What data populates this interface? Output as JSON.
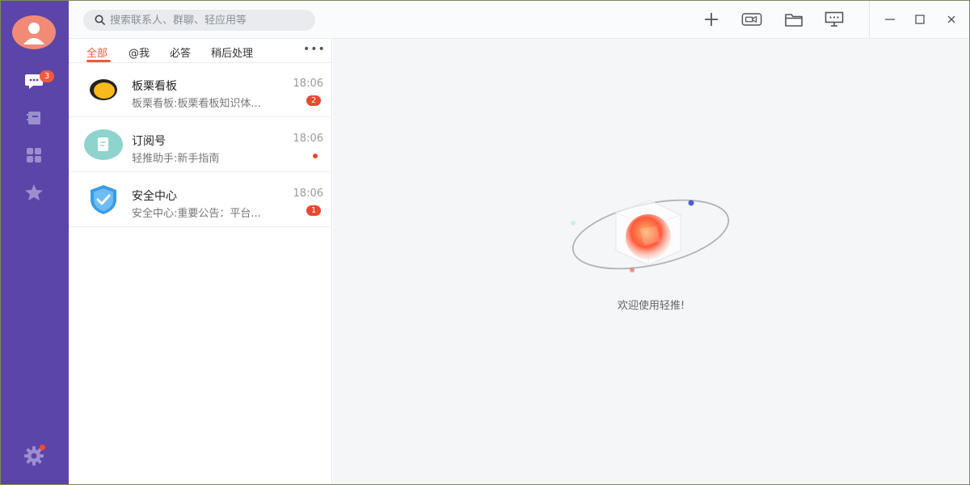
{
  "rail": {
    "chat_badge": "3"
  },
  "search": {
    "placeholder": "搜索联系人、群聊、轻应用等"
  },
  "tabs": [
    "全部",
    "@我",
    "必答",
    "稍后处理"
  ],
  "conversations": [
    {
      "name": "板栗看板",
      "preview": "板栗看板:板栗看板知识体...",
      "time": "18:06",
      "unread": "2"
    },
    {
      "name": "订阅号",
      "preview": "轻推助手:新手指南",
      "time": "18:06",
      "unread": ""
    },
    {
      "name": "安全中心",
      "preview": "安全中心:重要公告：平台...",
      "time": "18:06",
      "unread": "1"
    }
  ],
  "main": {
    "welcome": "欢迎使用轻推!"
  },
  "colors": {
    "rail": "#5c45a8",
    "accent": "#ee5a3a",
    "badge": "#e8482d"
  }
}
